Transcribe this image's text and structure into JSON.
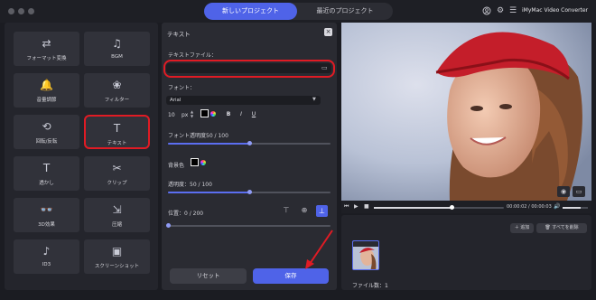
{
  "tabs": {
    "new_project": "新しいプロジェクト",
    "recent_project": "最近のプロジェクト"
  },
  "brand": "iMyMac Video Converter",
  "tools": [
    {
      "label": "フォーマット変換",
      "icon": "format-convert-icon",
      "glyph": "⇄"
    },
    {
      "label": "BGM",
      "icon": "bgm-icon",
      "glyph": "♫"
    },
    {
      "label": "音量調節",
      "icon": "volume-icon",
      "glyph": "🔔"
    },
    {
      "label": "フィルター",
      "icon": "filter-icon",
      "glyph": "❀"
    },
    {
      "label": "回転/反転",
      "icon": "rotate-icon",
      "glyph": "⟲"
    },
    {
      "label": "テキスト",
      "icon": "text-icon",
      "glyph": "T"
    },
    {
      "label": "透かし",
      "icon": "watermark-icon",
      "glyph": "T"
    },
    {
      "label": "クリップ",
      "icon": "clip-icon",
      "glyph": "✂"
    },
    {
      "label": "3D効果",
      "icon": "3d-glasses-icon",
      "glyph": "👓"
    },
    {
      "label": "圧縮",
      "icon": "compress-icon",
      "glyph": "⇲"
    },
    {
      "label": "ID3",
      "icon": "id3-icon",
      "glyph": "♪"
    },
    {
      "label": "スクリーンショット",
      "icon": "screenshot-icon",
      "glyph": "▣"
    }
  ],
  "panel": {
    "title": "テキスト",
    "text_file_label": "テキストファイル：",
    "text_file_value": "",
    "font_label": "フォント：",
    "font_value": "Arial",
    "font_size": "10",
    "font_unit": "px",
    "bold": "B",
    "italic": "I",
    "underline": "U",
    "font_opacity_label": "フォント透明度50 / 100",
    "font_opacity": 0.5,
    "bg_color_label": "背景色",
    "transparency_label": "透明度：50 / 100",
    "transparency": 0.5,
    "position_label": "位置：0 / 200",
    "position": 0,
    "reset": "リセット",
    "save": "保存"
  },
  "player": {
    "time": "00:00:02 / 00:00:03",
    "progress": 0.6,
    "volume": 0.7
  },
  "media": {
    "add": "追加",
    "delete_all": "すべてを削除",
    "file_count": "ファイル数：1"
  },
  "colors": {
    "accent": "#4f63e8",
    "highlight": "#e01b24",
    "font_color": "#000000",
    "bg_color": "#000000"
  }
}
